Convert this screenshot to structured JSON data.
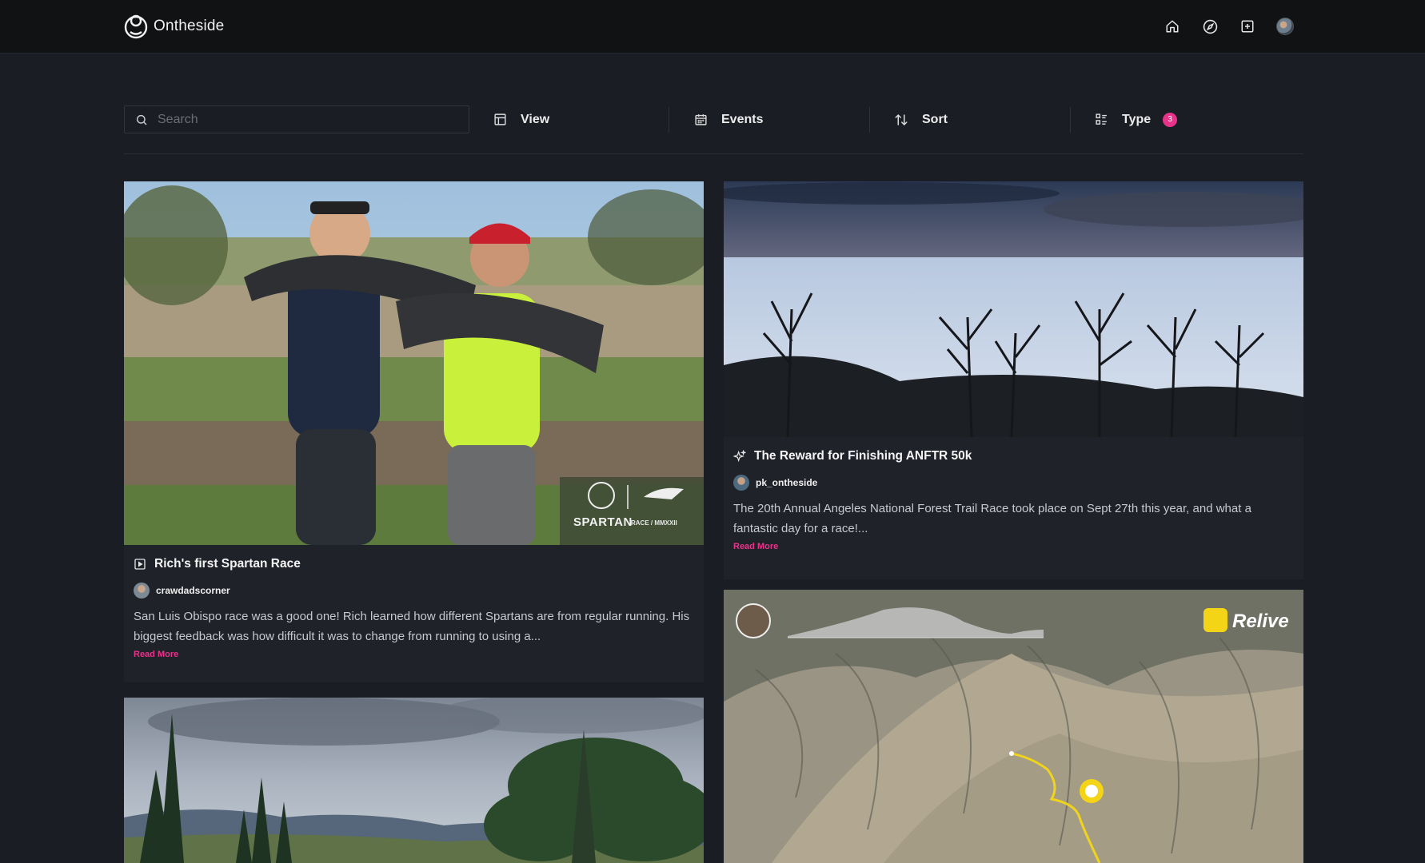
{
  "brand": {
    "name": "Ontheside"
  },
  "nav": {
    "icons": [
      "home-icon",
      "compass-icon",
      "plus-square-icon",
      "user-avatar"
    ]
  },
  "filters": {
    "search_placeholder": "Search",
    "view_label": "View",
    "events_label": "Events",
    "sort_label": "Sort",
    "type_label": "Type",
    "type_count": "3"
  },
  "colors": {
    "accent": "#e8338a",
    "background": "#1b1d24",
    "card": "#20222a",
    "topbar": "#111214"
  },
  "cards": [
    {
      "title": "Rich's first Spartan Race",
      "type_icon": "video-icon",
      "author": "crawdadscorner",
      "excerpt": "San Luis Obispo race was a good one! Rich learned how different Spartans are from regular running. His biggest feedback was how difficult it was to change from running to using a...",
      "read_more": "Read More",
      "image_text": {
        "brand": "SPARTAN",
        "sub": "RACE / MMXXII"
      }
    },
    {
      "title": "The Reward for Finishing ANFTR 50k",
      "type_icon": "sparkle-icon",
      "author": "pk_ontheside",
      "excerpt": "The 20th Annual Angeles National Forest Trail Race took place on Sept 27th this year, and what a fantastic day for a race!...",
      "read_more": "Read More"
    },
    {
      "image_text": {
        "brand": "Relive"
      }
    },
    {}
  ]
}
